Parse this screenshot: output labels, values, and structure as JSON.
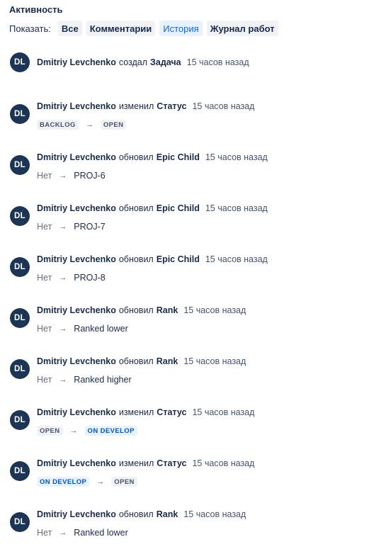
{
  "section": {
    "title": "Активность",
    "show_label": "Показать:",
    "filters": [
      {
        "label": "Все",
        "active": false
      },
      {
        "label": "Комментарии",
        "active": false
      },
      {
        "label": "История",
        "active": true
      },
      {
        "label": "Журнал работ",
        "active": false
      }
    ]
  },
  "entries": [
    {
      "avatar": "DL",
      "author": "Dmitriy Levchenko",
      "verb": "создал",
      "field": "Задача",
      "time": "15 часов назад",
      "from": null,
      "to": null
    },
    {
      "avatar": "DL",
      "author": "Dmitriy Levchenko",
      "verb": "изменил",
      "field": "Статус",
      "time": "15 часов назад",
      "from": {
        "text": "BACKLOG",
        "kind": "lozenge",
        "color": "grey"
      },
      "to": {
        "text": "OPEN",
        "kind": "lozenge",
        "color": "grey"
      }
    },
    {
      "avatar": "DL",
      "author": "Dmitriy Levchenko",
      "verb": "обновил",
      "field": "Epic Child",
      "time": "15 часов назад",
      "from": {
        "text": "Нет",
        "kind": "text"
      },
      "to": {
        "text": "PROJ-6",
        "kind": "text"
      }
    },
    {
      "avatar": "DL",
      "author": "Dmitriy Levchenko",
      "verb": "обновил",
      "field": "Epic Child",
      "time": "15 часов назад",
      "from": {
        "text": "Нет",
        "kind": "text"
      },
      "to": {
        "text": "PROJ-7",
        "kind": "text"
      }
    },
    {
      "avatar": "DL",
      "author": "Dmitriy Levchenko",
      "verb": "обновил",
      "field": "Epic Child",
      "time": "15 часов назад",
      "from": {
        "text": "Нет",
        "kind": "text"
      },
      "to": {
        "text": "PROJ-8",
        "kind": "text"
      }
    },
    {
      "avatar": "DL",
      "author": "Dmitriy Levchenko",
      "verb": "обновил",
      "field": "Rank",
      "time": "15 часов назад",
      "from": {
        "text": "Нет",
        "kind": "text"
      },
      "to": {
        "text": "Ranked lower",
        "kind": "text"
      }
    },
    {
      "avatar": "DL",
      "author": "Dmitriy Levchenko",
      "verb": "обновил",
      "field": "Rank",
      "time": "15 часов назад",
      "from": {
        "text": "Нет",
        "kind": "text"
      },
      "to": {
        "text": "Ranked higher",
        "kind": "text"
      }
    },
    {
      "avatar": "DL",
      "author": "Dmitriy Levchenko",
      "verb": "изменил",
      "field": "Статус",
      "time": "15 часов назад",
      "from": {
        "text": "OPEN",
        "kind": "lozenge",
        "color": "grey"
      },
      "to": {
        "text": "ON DEVELOP",
        "kind": "lozenge",
        "color": "blue"
      }
    },
    {
      "avatar": "DL",
      "author": "Dmitriy Levchenko",
      "verb": "изменил",
      "field": "Статус",
      "time": "15 часов назад",
      "from": {
        "text": "ON DEVELOP",
        "kind": "lozenge",
        "color": "blue"
      },
      "to": {
        "text": "OPEN",
        "kind": "lozenge",
        "color": "grey"
      }
    },
    {
      "avatar": "DL",
      "author": "Dmitriy Levchenko",
      "verb": "обновил",
      "field": "Rank",
      "time": "15 часов назад",
      "from": {
        "text": "Нет",
        "kind": "text"
      },
      "to": {
        "text": "Ranked lower",
        "kind": "text"
      }
    }
  ],
  "arrow_glyph": "→",
  "colors": {
    "avatar_bg": "#1d3554",
    "active_filter_bg": "#e9f2ff",
    "active_filter_text": "#0c66e4",
    "lozenge_grey_bg": "#f1f2f4",
    "lozenge_blue_bg": "#e9f2ff"
  }
}
